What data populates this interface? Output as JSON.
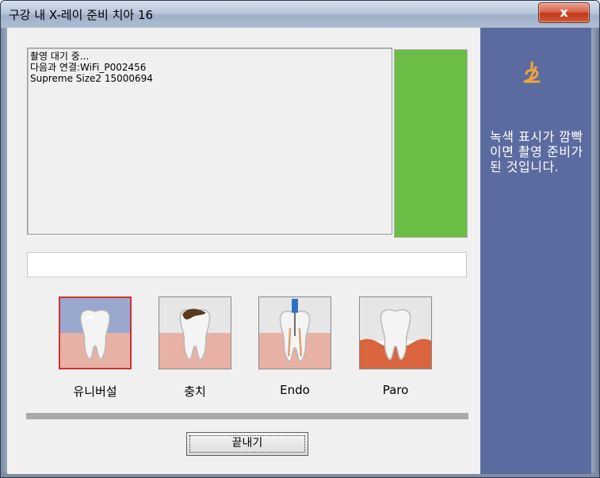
{
  "window": {
    "title": "구강 내 X-레이 준비 치아 16",
    "close_label": "x"
  },
  "status": {
    "lines": [
      "촬영 대기 중...",
      "다음과 연결:WiFi_P002456",
      "Supreme Size2 15000694"
    ]
  },
  "indicator": {
    "color": "#6cbd45"
  },
  "side_panel": {
    "icon": "probe-icon",
    "hint_text": "녹색 표시가 깜빡이면 촬영 준비가 된 것입니다.",
    "background": "#5b6ba0"
  },
  "modes": [
    {
      "label": "유니버설",
      "icon": "tooth-universal-icon",
      "selected": true
    },
    {
      "label": "충치",
      "icon": "tooth-caries-icon",
      "selected": false
    },
    {
      "label": "Endo",
      "icon": "tooth-endo-icon",
      "selected": false
    },
    {
      "label": "Paro",
      "icon": "tooth-paro-icon",
      "selected": false
    }
  ],
  "buttons": {
    "exit_label": "끝내기"
  }
}
